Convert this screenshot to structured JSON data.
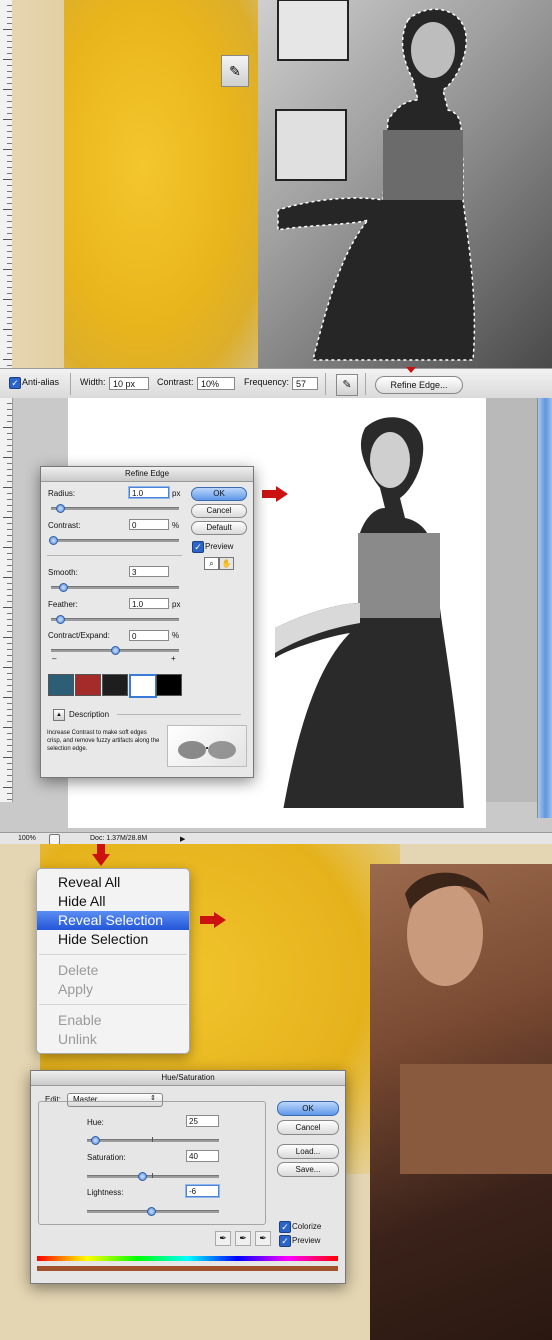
{
  "toolbar": {
    "anti_alias_label": "Anti-alias",
    "width_label": "Width:",
    "width_value": "10 px",
    "contrast_label": "Contrast:",
    "contrast_value": "10%",
    "frequency_label": "Frequency:",
    "frequency_value": "57",
    "refine_edge_button": "Refine Edge..."
  },
  "refine_edge": {
    "title": "Refine Edge",
    "radius_label": "Radius:",
    "radius_value": "1.0",
    "radius_unit": "px",
    "contrast_label": "Contrast:",
    "contrast_value": "0",
    "contrast_unit": "%",
    "smooth_label": "Smooth:",
    "smooth_value": "3",
    "feather_label": "Feather:",
    "feather_value": "1.0",
    "feather_unit": "px",
    "contract_label": "Contract/Expand:",
    "contract_value": "0",
    "contract_unit": "%",
    "minus": "–",
    "plus": "+",
    "ok_button": "OK",
    "cancel_button": "Cancel",
    "default_button": "Default",
    "preview_label": "Preview",
    "description_label": "Description",
    "description_text": "Increase Contrast to make soft edges crisp, and remove fuzzy artifacts along the selection edge."
  },
  "status_bar": {
    "zoom": "100%",
    "doc_info": "Doc: 1.37M/28.8M"
  },
  "context_menu": {
    "items": [
      {
        "label": "Reveal All",
        "state": "enabled"
      },
      {
        "label": "Hide All",
        "state": "enabled"
      },
      {
        "label": "Reveal Selection",
        "state": "selected"
      },
      {
        "label": "Hide Selection",
        "state": "enabled"
      },
      {
        "label": "Delete",
        "state": "disabled"
      },
      {
        "label": "Apply",
        "state": "disabled"
      },
      {
        "label": "Enable",
        "state": "disabled"
      },
      {
        "label": "Unlink",
        "state": "disabled"
      }
    ]
  },
  "hue_saturation": {
    "title": "Hue/Saturation",
    "edit_label": "Edit:",
    "edit_value": "Master",
    "hue_label": "Hue:",
    "hue_value": "25",
    "saturation_label": "Saturation:",
    "saturation_value": "40",
    "lightness_label": "Lightness:",
    "lightness_value": "-6",
    "ok_button": "OK",
    "cancel_button": "Cancel",
    "load_button": "Load...",
    "save_button": "Save...",
    "colorize_label": "Colorize",
    "preview_label": "Preview"
  },
  "colors": {
    "accent_blue": "#2255d8",
    "arrow_red": "#cc1111",
    "photoshop_yellow": "#ebb71e",
    "sepia_bar": "#a0522d"
  }
}
